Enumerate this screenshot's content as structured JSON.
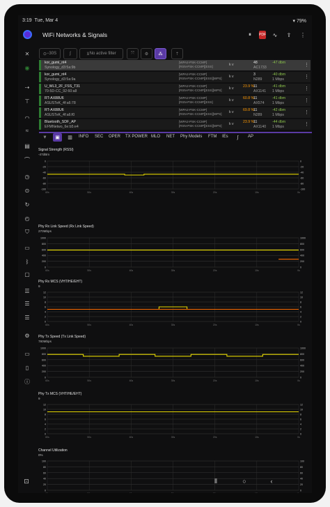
{
  "status": {
    "time": "3:19",
    "date": "Tue, Mar 4",
    "battery": "79%"
  },
  "app": {
    "title": "WiFi Networks & Signals"
  },
  "toolbar": {
    "timer": "−30S",
    "filter": "No active filter"
  },
  "networks": [
    {
      "ssid": "kor_gumi_nt4",
      "bssid": "Synology_d3:5a:9b",
      "security": "[WPA2-PSK-CCMP]\n[RSN-PSK-CCMP][ESS]",
      "kv": "k v",
      "channel": "48",
      "band": "AC1733",
      "signal": "-47 dbm",
      "rate": ""
    },
    {
      "ssid": "kor_gumi_nt4",
      "bssid": "Synology_d3:5a:9a",
      "security": "[WPA2-PSK-CCMP]\n[RSN-PSK-CCMP][ESS][WPS]",
      "kv": "k v",
      "channel": "3",
      "band": "N289",
      "signal": "-40 dbm",
      "rate": "1 Mbps"
    },
    {
      "ssid": "U_WL3_2F_FSS_T31",
      "bssid": "70-5D-CC_92:60:a8",
      "security": "[WPA2-PSK-CCMP]\n[RSN-PSK-CCMP][ESS][WPS]",
      "kv": "k v",
      "channel": "11",
      "band": "AX1141",
      "signal": "-41 dbm",
      "rate": "1 Mbps",
      "pct": "23.9 %"
    },
    {
      "ssid": "RT-AX88U6",
      "bssid": "ASUSTeK_4f:a6:78",
      "security": "[WPA2-PSK-CCMP]\n[RSN-PSK-CCMP][ESS]",
      "kv": "k v",
      "channel": "11",
      "band": "AX574",
      "signal": "-41 dbm",
      "rate": "1 Mbps",
      "pct": "60.8 %"
    },
    {
      "ssid": "RT-AX88U6",
      "bssid": "ASUSTeK_4f:a6:f0",
      "security": "[WPA2-PSK-CCMP]\n[RSN-PSK-CCMP][ESS][WPS]",
      "kv": "k v",
      "channel": "11",
      "band": "N289",
      "signal": "-42 dbm",
      "rate": "1 Mbps",
      "pct": "69.8 %"
    },
    {
      "ssid": "Bluetooth_SDF_AP",
      "bssid": "EFMNetwo_6e:b5:e4",
      "security": "[WPA2-PSK-CCMP]\n[RSN-PSK-CCMP][ESS][WPS]",
      "kv": "k v",
      "channel": "11",
      "band": "AX1140",
      "signal": "-44 dbm",
      "rate": "1 Mbps",
      "pct": "23.9 %"
    }
  ],
  "tabs": [
    "INFO",
    "SEC",
    "OPER",
    "TX POWER",
    "MLO",
    "NET",
    "Phy Models",
    "FTM",
    "IEs",
    "AP"
  ],
  "chart_data": [
    {
      "type": "line",
      "title": "Signal Strength (RSSI)",
      "subtitle": "-47dBm",
      "x": [
        -60,
        -50,
        -40,
        -30,
        -20,
        -10,
        0
      ],
      "ylim": [
        -100,
        0
      ],
      "yticks": [
        0,
        -20,
        -40,
        -60,
        -80,
        -100
      ],
      "xtick_labels": [
        "60s",
        "50s",
        "40s",
        "30s",
        "20s",
        "10s",
        "0s"
      ],
      "series": [
        {
          "values": [
            -47,
            -47,
            -47,
            -47,
            -50,
            -47,
            -47,
            -47,
            -47,
            -47,
            -47,
            -47,
            -47
          ],
          "color": "#e6d800"
        }
      ]
    },
    {
      "type": "line",
      "title": "Phy Rx Link Speed (Rx Link Speed)",
      "subtitle": "270Mbps",
      "ylim": [
        0,
        1000
      ],
      "yticks": [
        1000,
        800,
        600,
        400,
        200,
        0
      ],
      "xtick_labels": [
        "60s",
        "50s",
        "40s",
        "30s",
        "20s",
        "10s",
        "0s"
      ],
      "series": [
        {
          "values": [
            580,
            580,
            580,
            580,
            580,
            580,
            580,
            580,
            580,
            580,
            580,
            580,
            580
          ],
          "color": "#e6d800"
        },
        {
          "values": [
            270,
            270
          ],
          "color": "#ff6d00"
        }
      ]
    },
    {
      "type": "line",
      "title": "Phy Rx MCS (VHT/HE/EHT)",
      "subtitle": "9",
      "ylim": [
        0,
        12
      ],
      "yticks": [
        12,
        10,
        8,
        6,
        4,
        2,
        0
      ],
      "xtick_labels": [
        "60s",
        "50s",
        "40s",
        "30s",
        "20s",
        "10s",
        "0s"
      ],
      "series": [
        {
          "values": [
            5,
            5,
            5,
            5,
            6,
            5,
            5,
            5,
            5
          ],
          "color": "#e6d800"
        },
        {
          "values": [
            5,
            5,
            5,
            5,
            5,
            5
          ],
          "color": "#ff6d00"
        }
      ]
    },
    {
      "type": "line",
      "title": "Phy Tx Speed (Tx Link Speed)",
      "subtitle": "780Mbps",
      "ylim": [
        0,
        1000
      ],
      "yticks": [
        1000,
        800,
        600,
        400,
        200,
        0
      ],
      "xtick_labels": [
        "60s",
        "50s",
        "40s",
        "30s",
        "20s",
        "10s",
        "0s"
      ],
      "series": [
        {
          "values": [
            780,
            720,
            780,
            720,
            780,
            720,
            780
          ],
          "color": "#e6d800"
        }
      ]
    },
    {
      "type": "line",
      "title": "Phy Tx MCS (VHT/HE/EHT)",
      "subtitle": "9",
      "ylim": [
        0,
        12
      ],
      "yticks": [
        12,
        10,
        8,
        6,
        4,
        2,
        0
      ],
      "xtick_labels": [
        "60s",
        "50s",
        "40s",
        "30s",
        "20s",
        "10s",
        "0s"
      ],
      "series": [
        {
          "values": [
            9,
            9,
            9,
            9,
            9,
            9,
            9
          ],
          "color": "#e6d800"
        }
      ]
    },
    {
      "type": "line",
      "title": "Channel Utilization",
      "subtitle": "0%",
      "ylim": [
        0,
        100
      ],
      "yticks": [
        100,
        80,
        60,
        40,
        20,
        0
      ],
      "xtick_labels": [
        "60s",
        "50s",
        "40s",
        "30s",
        "20s",
        "10s",
        "0s"
      ],
      "series": []
    }
  ]
}
